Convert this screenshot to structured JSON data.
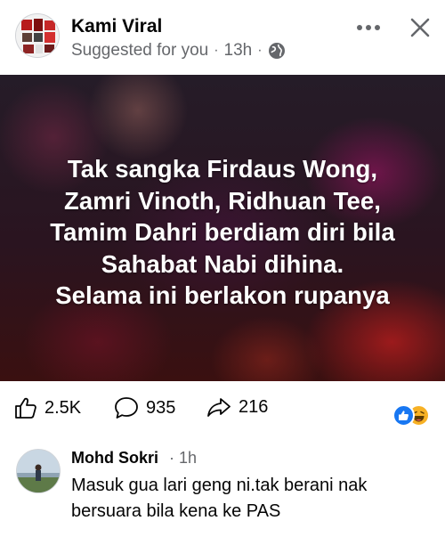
{
  "post": {
    "page_name": "Kami Viral",
    "suggested_label": "Suggested for you",
    "separator": "·",
    "time": "13h",
    "image_text_lines": [
      "Tak sangka Firdaus Wong,",
      "Zamri Vinoth, Ridhuan Tee,",
      "Tamim Dahri berdiam diri bila",
      "Sahabat Nabi dihina.",
      "Selama ini berlakon rupanya"
    ]
  },
  "actions": {
    "like_count": "2.5K",
    "comment_count": "935",
    "share_count": "216"
  },
  "reactions": [
    "like-icon",
    "haha-icon"
  ],
  "comment": {
    "author": "Mohd Sokri",
    "time": "· 1h",
    "text": "Masuk gua lari geng ni.tak berani nak bersuara bila kena ke PAS"
  },
  "colors": {
    "brand_blue": "#1877f2",
    "secondary_text": "#65676b",
    "haha_yellow": "#f7b125"
  }
}
